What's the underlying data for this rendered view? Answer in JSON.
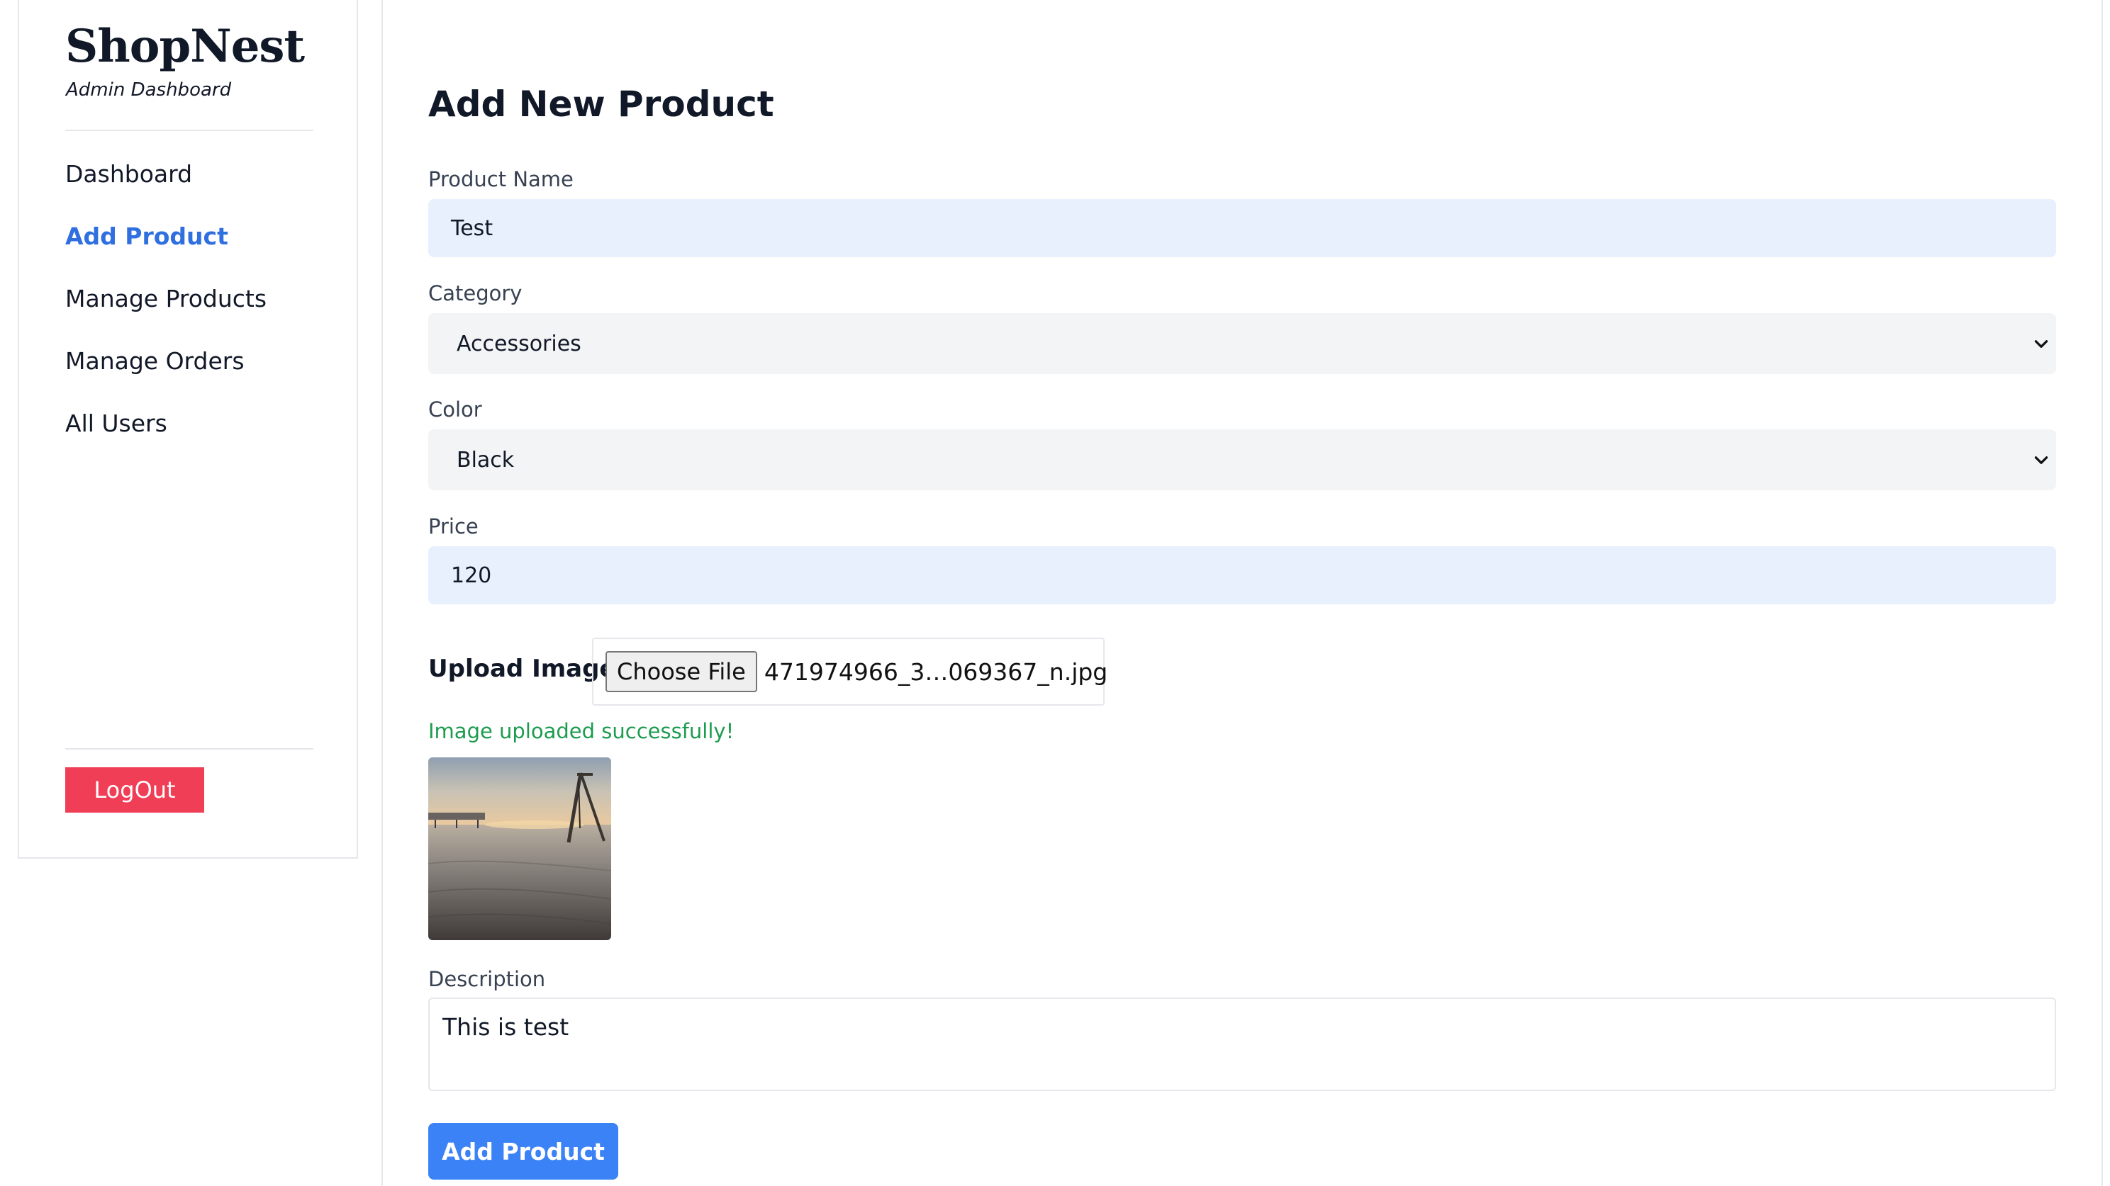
{
  "sidebar": {
    "brand": "ShopNest",
    "subtitle": "Admin Dashboard",
    "items": [
      {
        "label": "Dashboard",
        "active": false
      },
      {
        "label": "Add Product",
        "active": true
      },
      {
        "label": "Manage Products",
        "active": false
      },
      {
        "label": "Manage Orders",
        "active": false
      },
      {
        "label": "All Users",
        "active": false
      }
    ],
    "logout_label": "LogOut"
  },
  "form": {
    "title": "Add New Product",
    "product_name": {
      "label": "Product Name",
      "value": "Test"
    },
    "category": {
      "label": "Category",
      "value": "Accessories"
    },
    "color": {
      "label": "Color",
      "value": "Black"
    },
    "price": {
      "label": "Price",
      "value": "120"
    },
    "upload": {
      "label": "Upload Image",
      "button_label": "Choose File",
      "file_name": "471974966_3…069367_n.jpg",
      "status": "Image uploaded successfully!"
    },
    "description": {
      "label": "Description",
      "value": "This is test"
    },
    "submit_label": "Add Product"
  },
  "colors": {
    "accent": "#2f6fe0",
    "primary_button": "#3b82f6",
    "logout_button": "#ef3e55",
    "success": "#1d9c4f",
    "filled_input": "#e8f0fe",
    "select_bg": "#f3f4f6"
  }
}
